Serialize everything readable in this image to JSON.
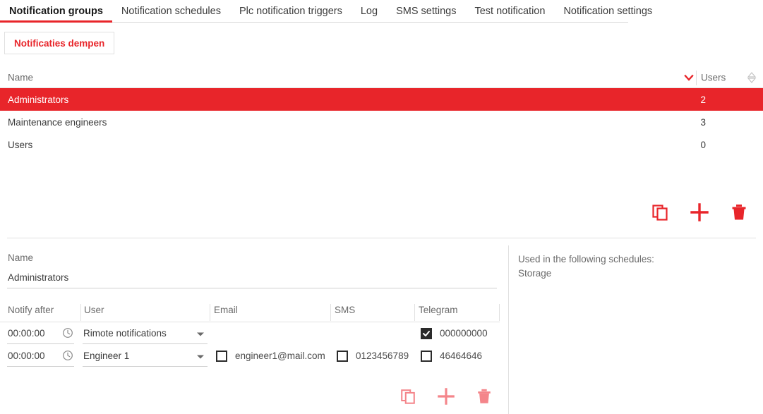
{
  "colors": {
    "accent_red": "#e8252a",
    "accent_red_light": "#f4858a",
    "text_dark": "#3b3b3b",
    "text_muted": "#6a6a6a",
    "divider": "#e0e0e0",
    "checkbox_dark": "#2b2b2b"
  },
  "tabs": [
    {
      "label": "Notification groups",
      "active": true
    },
    {
      "label": "Notification schedules",
      "active": false
    },
    {
      "label": "Plc notification triggers",
      "active": false
    },
    {
      "label": "Log",
      "active": false
    },
    {
      "label": "SMS settings",
      "active": false
    },
    {
      "label": "Test notification",
      "active": false
    },
    {
      "label": "Notification settings",
      "active": false
    }
  ],
  "toolbar": {
    "mute_button_label": "Notificaties dempen"
  },
  "groups_table": {
    "columns": {
      "name": "Name",
      "users": "Users"
    },
    "sort_icon_name": "chevron-down-icon",
    "users_sort_icon_name": "sort-updown-icon",
    "rows": [
      {
        "name": "Administrators",
        "users": "2",
        "selected": true
      },
      {
        "name": "Maintenance engineers",
        "users": "3",
        "selected": false
      },
      {
        "name": "Users",
        "users": "0",
        "selected": false
      }
    ]
  },
  "group_actions": {
    "copy_label": "copy-icon",
    "add_label": "plus-icon",
    "delete_label": "trash-icon"
  },
  "detail": {
    "name_label": "Name",
    "name_value": "Administrators",
    "used_in_title": "Used in the following schedules:",
    "used_in_items": [
      "Storage"
    ]
  },
  "recipients_table": {
    "columns": [
      "Notify after",
      "User",
      "Email",
      "SMS",
      "Telegram"
    ],
    "rows": [
      {
        "notify_after": "00:00:00",
        "user": "Rimote notifications",
        "email_checked": false,
        "email": "",
        "sms_checked": false,
        "sms": "",
        "telegram_checked": true,
        "telegram": "000000000"
      },
      {
        "notify_after": "00:00:00",
        "user": "Engineer 1",
        "email_checked": false,
        "email": "engineer1@mail.com",
        "sms_checked": false,
        "sms": "0123456789",
        "telegram_checked": false,
        "telegram": "46464646"
      }
    ]
  },
  "recipient_actions": {
    "copy_label": "copy-icon",
    "add_label": "plus-icon",
    "delete_label": "trash-icon"
  }
}
